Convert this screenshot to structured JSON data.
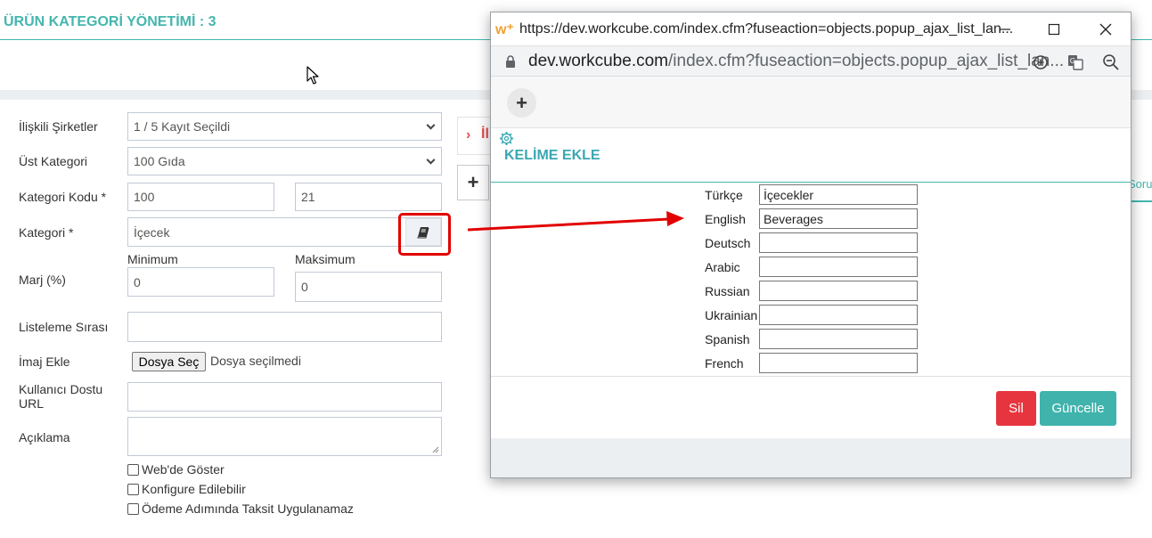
{
  "page": {
    "title": "ÜRÜN KATEGORİ YÖNETİMİ : 3",
    "form": {
      "companies_label": "İlişkili Şirketler",
      "companies_value": "1 / 5 Kayıt Seçildi",
      "parent_label": "Üst Kategori",
      "parent_value": "100 Gıda",
      "code_label": "Kategori Kodu *",
      "code_value_1": "100",
      "code_value_2": "21",
      "category_label": "Kategori *",
      "category_value": "İçecek",
      "margin_label": "Marj (%)",
      "min_label": "Minimum",
      "max_label": "Maksimum",
      "min_value": "0",
      "max_value": "0",
      "order_label": "Listeleme Sırası",
      "image_label": "İmaj Ekle",
      "file_button": "Dosya Seç",
      "file_status": "Dosya seçilmedi",
      "url_label": "Kullanıcı Dostu URL",
      "desc_label": "Açıklama",
      "chk_web": "Web'de Göster",
      "chk_config": "Konfigure Edilebilir",
      "chk_installment": "Ödeme Adımında Taksit Uygulanamaz"
    },
    "right_panel": {
      "related_partial": "İli",
      "add": "+",
      "tab_partial": "Sorul"
    }
  },
  "popup": {
    "logo": "w⁺",
    "window_title": "https://dev.workcube.com/index.cfm?fuseaction=objects.popup_ajax_list_lan...",
    "url_host": "dev.workcube.com",
    "url_path": "/index.cfm?fuseaction=objects.popup_ajax_list_lan...",
    "add_button": "+",
    "heading": "KELİME EKLE",
    "languages": [
      {
        "label": "Türkçe",
        "value": "İçecekler"
      },
      {
        "label": "English",
        "value": "Beverages"
      },
      {
        "label": "Deutsch",
        "value": ""
      },
      {
        "label": "Arabic",
        "value": ""
      },
      {
        "label": "Russian",
        "value": ""
      },
      {
        "label": "Ukrainian",
        "value": ""
      },
      {
        "label": "Spanish",
        "value": ""
      },
      {
        "label": "French",
        "value": ""
      }
    ],
    "delete_button": "Sil",
    "update_button": "Güncelle"
  },
  "colors": {
    "accent": "#44b6ae",
    "danger": "#e7353f",
    "annotation_red": "#e20000"
  }
}
